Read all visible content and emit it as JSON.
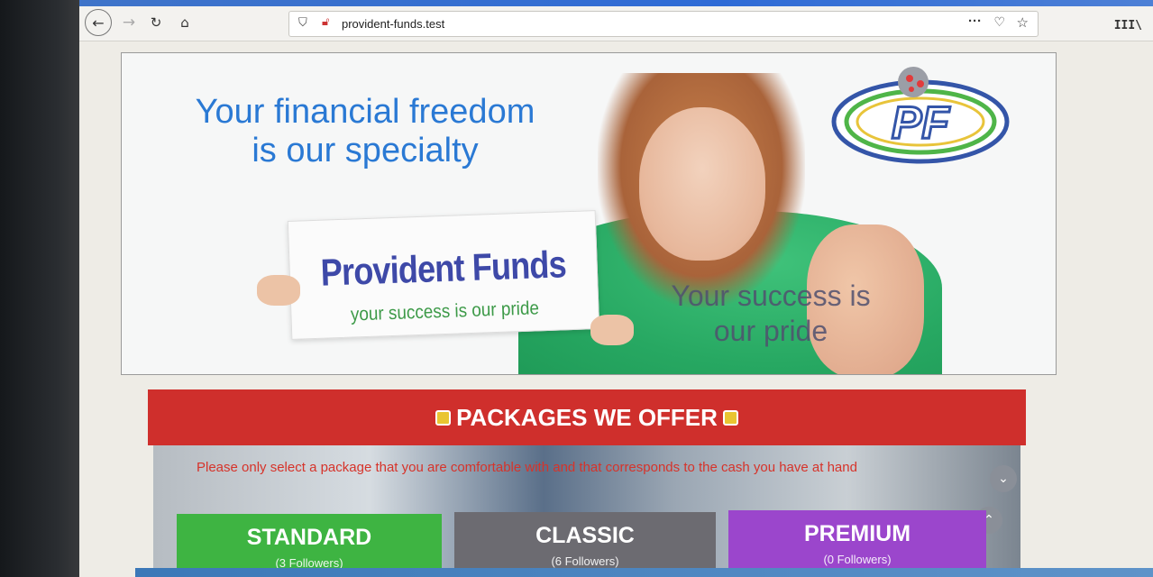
{
  "browser": {
    "url": "provident-funds.test",
    "icons": [
      "back-icon",
      "forward-icon",
      "reload-icon",
      "home-icon",
      "shield-icon",
      "insecure-lock-icon",
      "more-icon",
      "pocket-icon",
      "bookmark-star-icon",
      "library-icon"
    ]
  },
  "hero": {
    "headline_line1": "Your financial freedom",
    "headline_line2": "is our specialty",
    "sign_title": "Provident Funds",
    "sign_subtitle": "your success is our pride",
    "tagline_line1": "Your success is",
    "tagline_line2": "our pride",
    "logo_text": "PF"
  },
  "packages": {
    "title": "PACKAGES WE OFFER",
    "note": "Please only select a package that you are comfortable with and that corresponds to the cash you have at hand",
    "cards": [
      {
        "name": "STANDARD",
        "followers": "(3 Followers)",
        "color": "#3eb442"
      },
      {
        "name": "CLASSIC",
        "followers": "(6 Followers)",
        "color": "#6c6b71"
      },
      {
        "name": "PREMIUM",
        "followers": "(0 Followers)",
        "color": "#9b46cc"
      }
    ]
  },
  "colors": {
    "headline": "#2a79d4",
    "section_header": "#cf2f2c",
    "note_text": "#d6332a"
  }
}
